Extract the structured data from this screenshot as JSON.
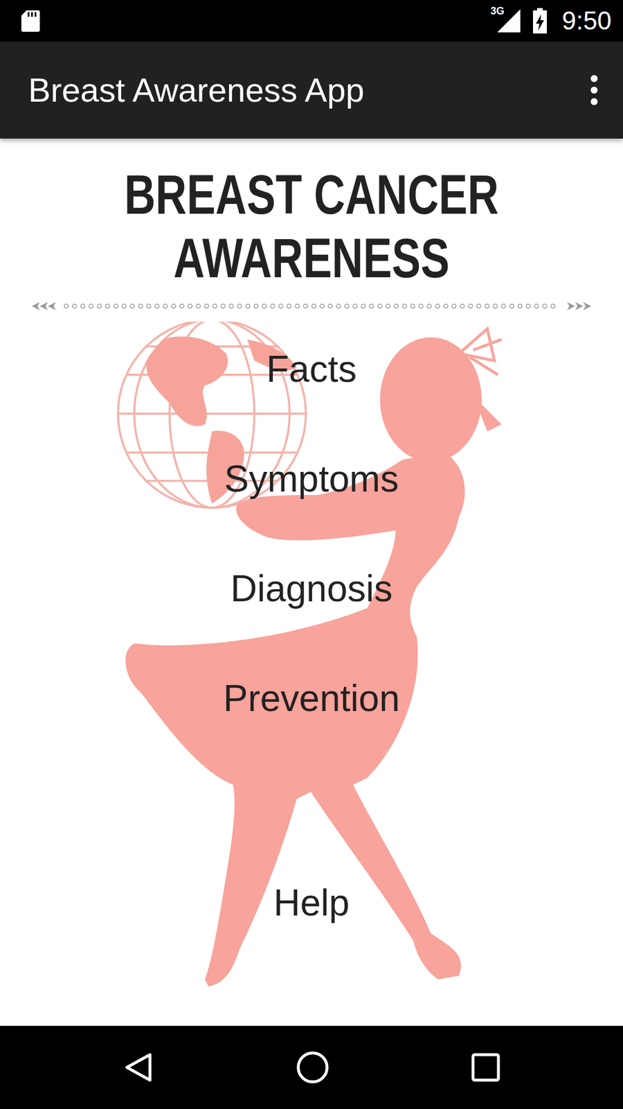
{
  "status_bar": {
    "network": "3G",
    "time": "9:50"
  },
  "app_bar": {
    "title": "Breast Awareness App"
  },
  "heading": {
    "lines": [
      "BREAST CANCER",
      "AWARENESS"
    ]
  },
  "menu": [
    {
      "label": "Facts"
    },
    {
      "label": "Symptoms"
    },
    {
      "label": "Diagnosis"
    },
    {
      "label": "Prevention"
    },
    {
      "label": "Help"
    }
  ]
}
